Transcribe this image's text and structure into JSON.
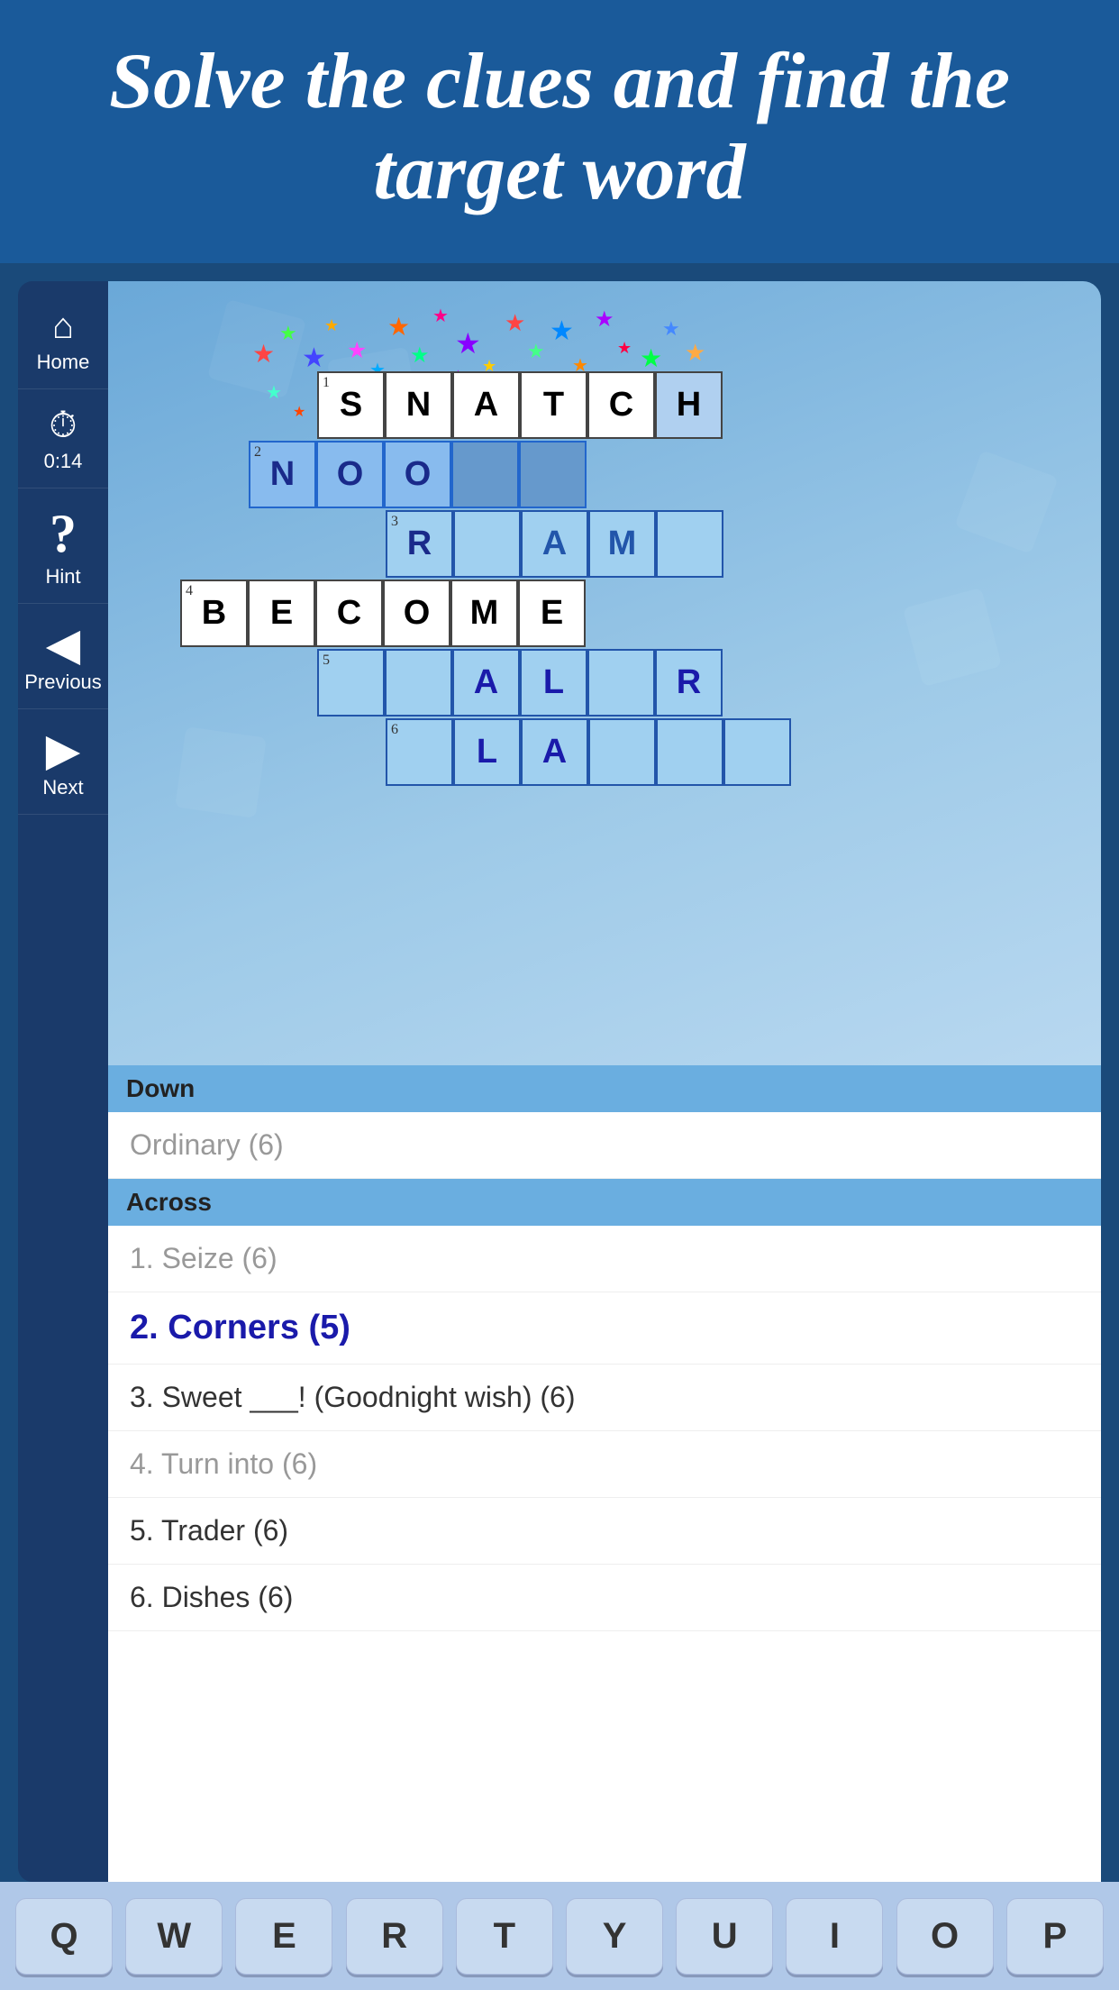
{
  "header": {
    "title": "Solve the clues and find the target word"
  },
  "sidebar": {
    "home_label": "Home",
    "timer_value": "0:14",
    "hint_label": "Hint",
    "previous_label": "Previous",
    "next_label": "Next"
  },
  "grid": {
    "rows": [
      {
        "y": 0,
        "cells": [
          {
            "x": 2,
            "letter": "S",
            "style": "solved"
          },
          {
            "x": 3,
            "letter": "N",
            "style": "solved"
          },
          {
            "x": 4,
            "letter": "A",
            "style": "solved"
          },
          {
            "x": 5,
            "letter": "T",
            "style": "solved"
          },
          {
            "x": 6,
            "letter": "C",
            "style": "solved"
          },
          {
            "x": 7,
            "letter": "H",
            "style": "solved"
          }
        ]
      },
      {
        "y": 1,
        "num": "2",
        "cells": [
          {
            "x": 1,
            "letter": "N",
            "style": "active",
            "num": "2"
          },
          {
            "x": 2,
            "letter": "O",
            "style": "active"
          },
          {
            "x": 3,
            "letter": "O",
            "style": "active"
          },
          {
            "x": 4,
            "letter": "",
            "style": "active"
          },
          {
            "x": 5,
            "letter": "",
            "style": "active"
          }
        ]
      },
      {
        "y": 2,
        "num": "3",
        "cells": [
          {
            "x": 3,
            "letter": "R",
            "style": "normal",
            "num": "3"
          },
          {
            "x": 5,
            "letter": "A",
            "style": "normal"
          },
          {
            "x": 6,
            "letter": "M",
            "style": "normal"
          },
          {
            "x": 7,
            "letter": "",
            "style": "normal"
          }
        ]
      },
      {
        "y": 3,
        "num": "4",
        "cells": [
          {
            "x": 0,
            "letter": "B",
            "style": "solved",
            "num": "4"
          },
          {
            "x": 1,
            "letter": "E",
            "style": "solved"
          },
          {
            "x": 2,
            "letter": "C",
            "style": "solved"
          },
          {
            "x": 3,
            "letter": "O",
            "style": "solved"
          },
          {
            "x": 4,
            "letter": "M",
            "style": "solved"
          },
          {
            "x": 5,
            "letter": "E",
            "style": "solved"
          }
        ]
      },
      {
        "y": 4,
        "num": "5",
        "cells": [
          {
            "x": 2,
            "letter": "",
            "style": "normal",
            "num": "5"
          },
          {
            "x": 3,
            "letter": "",
            "style": "normal"
          },
          {
            "x": 4,
            "letter": "A",
            "style": "normal"
          },
          {
            "x": 5,
            "letter": "L",
            "style": "normal"
          },
          {
            "x": 6,
            "letter": "",
            "style": "normal"
          },
          {
            "x": 7,
            "letter": "R",
            "style": "normal"
          }
        ]
      },
      {
        "y": 5,
        "num": "6",
        "cells": [
          {
            "x": 3,
            "letter": "L",
            "style": "normal",
            "num": "6"
          },
          {
            "x": 4,
            "letter": "A",
            "style": "normal"
          },
          {
            "x": 5,
            "letter": "",
            "style": "normal"
          },
          {
            "x": 6,
            "letter": "",
            "style": "normal"
          },
          {
            "x": 7,
            "letter": "",
            "style": "normal"
          }
        ]
      }
    ]
  },
  "clues": {
    "down_header": "Down",
    "down_items": [
      {
        "text": "Ordinary (6)",
        "style": "light"
      }
    ],
    "across_header": "Across",
    "across_items": [
      {
        "num": "1",
        "text": "Seize (6)",
        "style": "light"
      },
      {
        "num": "2",
        "text": "Corners (5)",
        "style": "active"
      },
      {
        "num": "3",
        "text": "Sweet ___! (Goodnight wish) (6)",
        "style": "dark"
      },
      {
        "num": "4",
        "text": "Turn into (6)",
        "style": "light"
      },
      {
        "num": "5",
        "text": "Trader (6)",
        "style": "dark"
      },
      {
        "num": "6",
        "text": "Dishes (6)",
        "style": "dark"
      }
    ]
  },
  "keyboard": {
    "keys": [
      "Q",
      "W",
      "E",
      "R",
      "T",
      "Y",
      "U",
      "I",
      "O",
      "P"
    ]
  }
}
